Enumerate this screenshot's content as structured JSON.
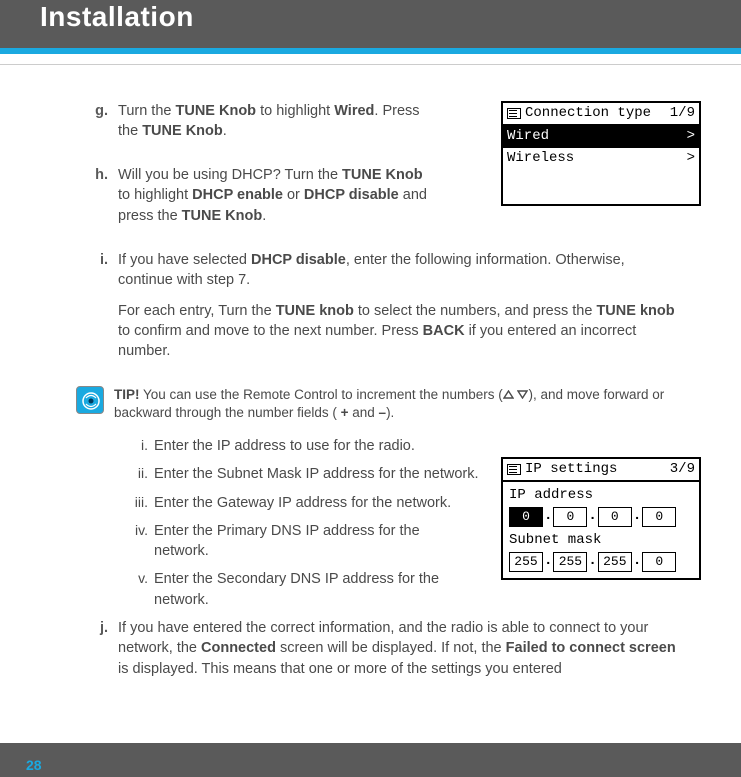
{
  "header": {
    "title": "Installation"
  },
  "page_number": "28",
  "steps": {
    "g": {
      "label": "g.",
      "text_1a": "Turn the ",
      "text_1b": "TUNE Knob",
      "text_1c": " to highlight ",
      "text_1d": "Wired",
      "text_1e": ". Press the ",
      "text_1f": "TUNE Knob",
      "text_1g": "."
    },
    "h": {
      "label": "h.",
      "text_1a": "Will you be using DHCP? Turn the ",
      "text_1b": "TUNE Knob",
      "text_1c": " to highlight ",
      "text_1d": "DHCP enable",
      "text_1e": " or ",
      "text_1f": "DHCP disable",
      "text_1g": " and press the ",
      "text_1h": "TUNE Knob",
      "text_1i": "."
    },
    "i": {
      "label": "i.",
      "p1a": "If you have selected ",
      "p1b": "DHCP disable",
      "p1c": ", enter the following information. Otherwise, continue with step 7.",
      "p2a": "For each entry, Turn the ",
      "p2b": "TUNE knob",
      "p2c": " to select the numbers, and press the ",
      "p2d": "TUNE knob",
      "p2e": " to confirm and move to the next number. Press ",
      "p2f": "BACK",
      "p2g": " if you entered an incorrect number."
    },
    "j": {
      "label": "j.",
      "text_a": "If you have entered the correct information, and the radio is able to connect to your network, the ",
      "text_b": "Connected",
      "text_c": " screen will be displayed. If not, the ",
      "text_d": "Failed to connect screen",
      "text_e": " is displayed. This means that one or more of the settings you entered"
    }
  },
  "tip": {
    "label": "TIP!",
    "text_a": " You can use the Remote Control to increment the numbers (",
    "text_b": "), and move forward or backward through the number fields ( ",
    "plus": "+",
    "and": " and ",
    "minus": "–",
    "text_c": ")."
  },
  "roman": {
    "i": {
      "label": "i.",
      "text": "Enter the IP address to use for the radio."
    },
    "ii": {
      "label": "ii.",
      "text": "Enter the Subnet Mask IP address for the network."
    },
    "iii": {
      "label": "iii.",
      "text": "Enter the Gateway IP address for the network."
    },
    "iv": {
      "label": "iv.",
      "text": "Enter the Primary DNS IP address for the network."
    },
    "v": {
      "label": "v.",
      "text": "Enter the Secondary DNS IP address for the network."
    }
  },
  "screen1": {
    "title": "Connection type",
    "page": "1/9",
    "row1": "Wired",
    "row1_arrow": ">",
    "row2": "Wireless",
    "row2_arrow": ">"
  },
  "screen2": {
    "title": "IP settings",
    "page": "3/9",
    "ip_label": "IP address",
    "ip": {
      "a": "0",
      "b": "0",
      "c": "0",
      "d": "0"
    },
    "subnet_label": "Subnet mask",
    "subnet": {
      "a": "255",
      "b": "255",
      "c": "255",
      "d": "0"
    }
  }
}
